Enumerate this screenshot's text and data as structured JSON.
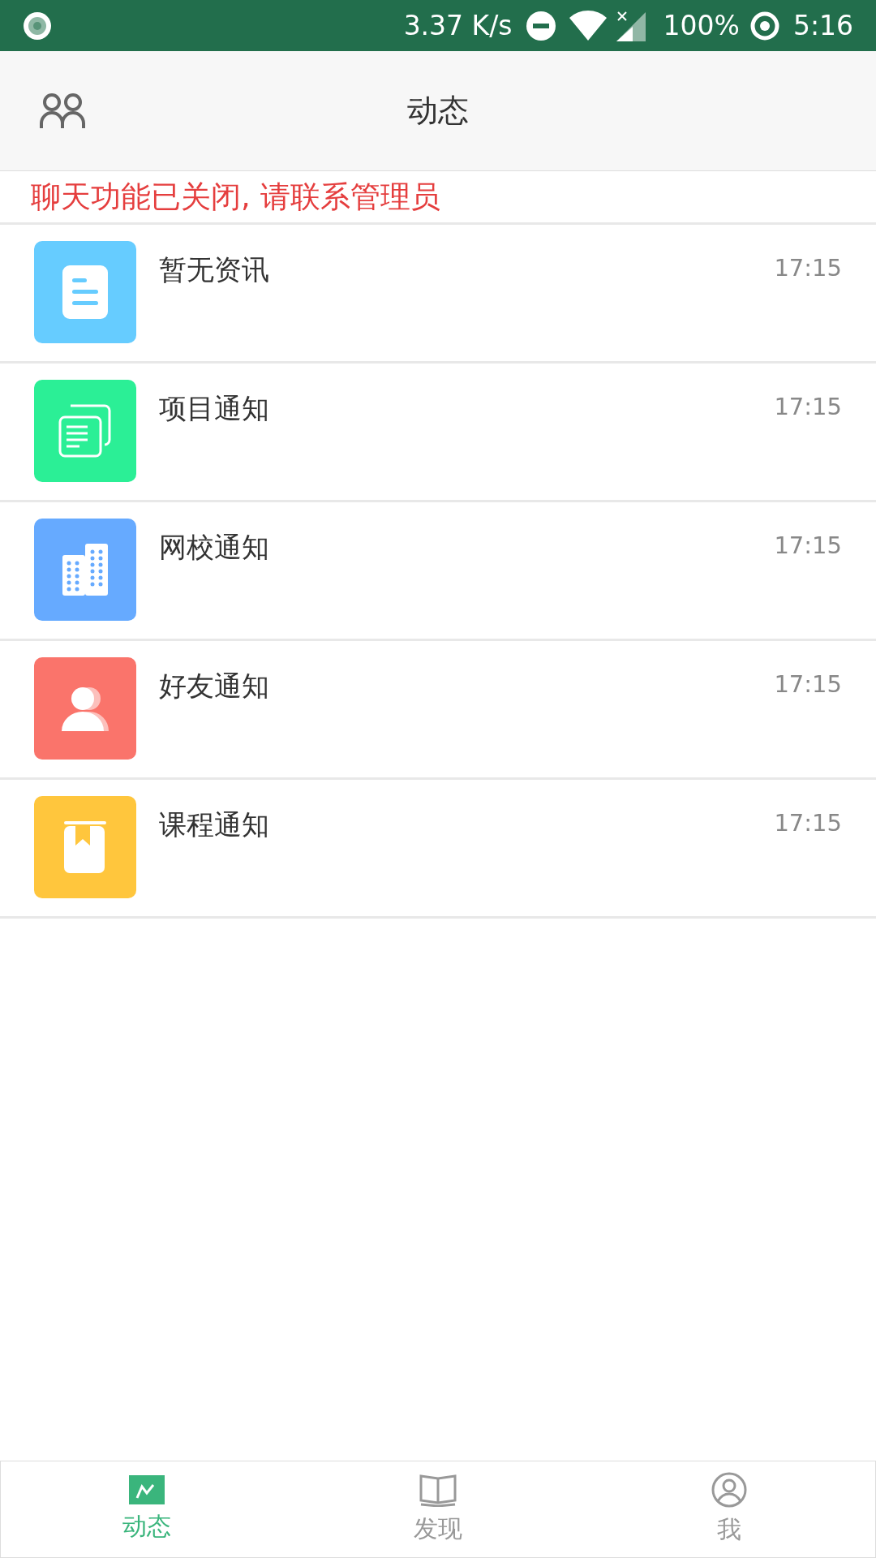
{
  "status_bar": {
    "speed": "3.37 K/s",
    "battery": "100%",
    "time": "5:16"
  },
  "header": {
    "title": "动态"
  },
  "notice": "聊天功能已关闭, 请联系管理员",
  "items": [
    {
      "kind": "document",
      "color": "#66ccff",
      "title": "暂无资讯",
      "time": "17:15"
    },
    {
      "kind": "copies",
      "color": "#2bef96",
      "title": "项目通知",
      "time": "17:15"
    },
    {
      "kind": "building",
      "color": "#66aaff",
      "title": "网校通知",
      "time": "17:15"
    },
    {
      "kind": "person",
      "color": "#fa746b",
      "title": "好友通知",
      "time": "17:15"
    },
    {
      "kind": "bookmark",
      "color": "#ffc63d",
      "title": "课程通知",
      "time": "17:15"
    }
  ],
  "tabs": [
    {
      "kind": "activity",
      "label": "动态",
      "selected": true
    },
    {
      "kind": "book",
      "label": "发现",
      "selected": false
    },
    {
      "kind": "profile",
      "label": "我",
      "selected": false
    }
  ]
}
